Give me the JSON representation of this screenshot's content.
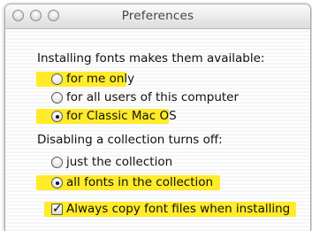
{
  "window": {
    "title": "Preferences"
  },
  "installing": {
    "heading": "Installing fonts makes them available:",
    "options": [
      {
        "label": "for me only",
        "selected": false
      },
      {
        "label": "for all users of this computer",
        "selected": false
      },
      {
        "label": "for Classic Mac OS",
        "selected": true
      }
    ]
  },
  "disabling": {
    "heading": "Disabling a collection turns off:",
    "options": [
      {
        "label": "just the collection",
        "selected": false
      },
      {
        "label": "all fonts in the collection",
        "selected": true
      }
    ]
  },
  "always_copy": {
    "label": "Always copy font files when installing",
    "checked": true
  },
  "colors": {
    "highlight": "#ffeb2a"
  }
}
